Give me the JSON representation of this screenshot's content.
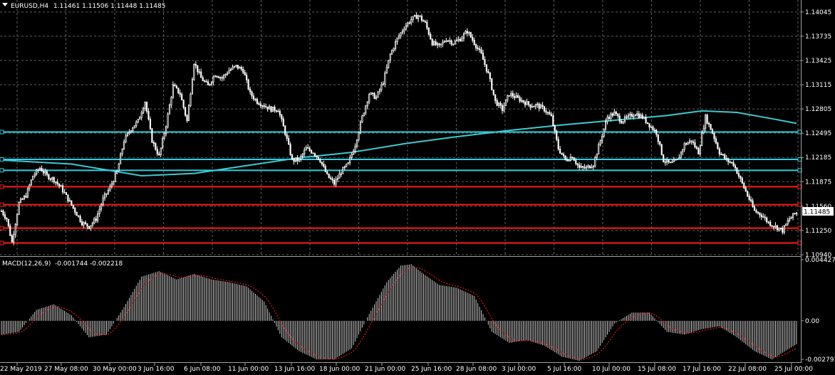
{
  "header": {
    "symbol_label": "EURUSD,H4",
    "ohlc": "1.11461 1.11506 1.11448 1.11485"
  },
  "macd": {
    "label": "MACD(12,26,9)",
    "values": "-0.001744 -0.002218"
  },
  "colors": {
    "background": "#000000",
    "grid": "#606060",
    "candle": "#ffffff",
    "ma": "#40c8d0",
    "cyan_level": "#30d0e0",
    "red_level": "#ff1a1a",
    "signal": "#ff2020",
    "text": "#ffffff",
    "price_box_bg": "#ffffff",
    "price_box_text": "#000000"
  },
  "price_axis": {
    "ticks": [
      "1.14045",
      "1.13735",
      "1.13425",
      "1.13115",
      "1.12805",
      "1.12495",
      "1.12185",
      "1.11875",
      "1.11560",
      "1.11250",
      "1.10940"
    ],
    "current": "1.11485"
  },
  "macd_axis": {
    "ticks": [
      "0.004427",
      "0.00",
      "-0.002793"
    ]
  },
  "time_axis": {
    "labels": [
      "22 May 2019",
      "27 May 08:00",
      "30 May 00:00",
      "3 Jun 16:00",
      "6 Jun 08:00",
      "11 Jun 00:00",
      "13 Jun 16:00",
      "18 Jun 00:00",
      "21 Jun 00:00",
      "25 Jun 16:00",
      "28 Jun 08:00",
      "3 Jul 00:00",
      "5 Jul 16:00",
      "10 Jul 00:00",
      "15 Jul 08:00",
      "17 Jul 16:00",
      "22 Jul 08:00",
      "25 Jul 00:00"
    ]
  },
  "chart_data": {
    "type": "candlestick",
    "symbol": "EURUSD",
    "timeframe": "H4",
    "ylim": [
      1.1094,
      1.1418
    ],
    "macd_range": [
      -0.002793,
      0.004427
    ],
    "horizontal_levels": {
      "cyan": [
        1.1251,
        1.1216,
        1.1202
      ],
      "red": [
        1.1181,
        1.1158,
        1.1128,
        1.1109
      ]
    },
    "close_path": [
      [
        0,
        1.115
      ],
      [
        3,
        1.114
      ],
      [
        6,
        1.111
      ],
      [
        10,
        1.116
      ],
      [
        14,
        1.117
      ],
      [
        18,
        1.1195
      ],
      [
        22,
        1.1205
      ],
      [
        26,
        1.1195
      ],
      [
        30,
        1.119
      ],
      [
        34,
        1.118
      ],
      [
        38,
        1.1165
      ],
      [
        42,
        1.115
      ],
      [
        46,
        1.1135
      ],
      [
        50,
        1.113
      ],
      [
        54,
        1.114
      ],
      [
        58,
        1.1165
      ],
      [
        62,
        1.118
      ],
      [
        66,
        1.12
      ],
      [
        70,
        1.124
      ],
      [
        74,
        1.1255
      ],
      [
        78,
        1.1265
      ],
      [
        82,
        1.129
      ],
      [
        86,
        1.124
      ],
      [
        90,
        1.122
      ],
      [
        94,
        1.126
      ],
      [
        98,
        1.131
      ],
      [
        102,
        1.13
      ],
      [
        106,
        1.1265
      ],
      [
        110,
        1.134
      ],
      [
        114,
        1.132
      ],
      [
        118,
        1.131
      ],
      [
        122,
        1.1325
      ],
      [
        126,
        1.132
      ],
      [
        130,
        1.133
      ],
      [
        134,
        1.1335
      ],
      [
        138,
        1.133
      ],
      [
        142,
        1.13
      ],
      [
        146,
        1.129
      ],
      [
        150,
        1.1285
      ],
      [
        154,
        1.128
      ],
      [
        158,
        1.128
      ],
      [
        162,
        1.125
      ],
      [
        166,
        1.1215
      ],
      [
        170,
        1.1215
      ],
      [
        174,
        1.123
      ],
      [
        178,
        1.1225
      ],
      [
        182,
        1.1215
      ],
      [
        186,
        1.1195
      ],
      [
        190,
        1.1185
      ],
      [
        194,
        1.12
      ],
      [
        198,
        1.121
      ],
      [
        202,
        1.1235
      ],
      [
        206,
        1.127
      ],
      [
        210,
        1.13
      ],
      [
        214,
        1.1295
      ],
      [
        218,
        1.1315
      ],
      [
        222,
        1.135
      ],
      [
        226,
        1.137
      ],
      [
        230,
        1.1385
      ],
      [
        234,
        1.1395
      ],
      [
        238,
        1.14
      ],
      [
        242,
        1.139
      ],
      [
        246,
        1.1365
      ],
      [
        250,
        1.136
      ],
      [
        254,
        1.137
      ],
      [
        258,
        1.1365
      ],
      [
        262,
        1.137
      ],
      [
        266,
        1.138
      ],
      [
        270,
        1.1365
      ],
      [
        274,
        1.135
      ],
      [
        278,
        1.1325
      ],
      [
        282,
        1.129
      ],
      [
        286,
        1.128
      ],
      [
        290,
        1.13
      ],
      [
        294,
        1.1295
      ],
      [
        298,
        1.129
      ],
      [
        302,
        1.1285
      ],
      [
        306,
        1.1285
      ],
      [
        310,
        1.128
      ],
      [
        314,
        1.127
      ],
      [
        318,
        1.123
      ],
      [
        322,
        1.1215
      ],
      [
        326,
        1.122
      ],
      [
        330,
        1.1205
      ],
      [
        334,
        1.1205
      ],
      [
        338,
        1.121
      ],
      [
        342,
        1.124
      ],
      [
        346,
        1.127
      ],
      [
        350,
        1.1275
      ],
      [
        354,
        1.1265
      ],
      [
        358,
        1.127
      ],
      [
        362,
        1.1275
      ],
      [
        366,
        1.127
      ],
      [
        370,
        1.126
      ],
      [
        374,
        1.125
      ],
      [
        378,
        1.1215
      ],
      [
        382,
        1.121
      ],
      [
        386,
        1.1215
      ],
      [
        390,
        1.1235
      ],
      [
        394,
        1.124
      ],
      [
        398,
        1.1225
      ],
      [
        402,
        1.127
      ],
      [
        406,
        1.125
      ],
      [
        410,
        1.1225
      ],
      [
        414,
        1.1215
      ],
      [
        418,
        1.121
      ],
      [
        422,
        1.119
      ],
      [
        426,
        1.117
      ],
      [
        430,
        1.115
      ],
      [
        434,
        1.1145
      ],
      [
        438,
        1.1135
      ],
      [
        442,
        1.113
      ],
      [
        446,
        1.1125
      ],
      [
        450,
        1.114
      ],
      [
        454,
        1.1148
      ]
    ],
    "moving_average": [
      [
        0,
        1.1215
      ],
      [
        40,
        1.121
      ],
      [
        80,
        1.1195
      ],
      [
        110,
        1.1198
      ],
      [
        140,
        1.1208
      ],
      [
        170,
        1.1218
      ],
      [
        200,
        1.1225
      ],
      [
        230,
        1.1236
      ],
      [
        260,
        1.1245
      ],
      [
        290,
        1.1253
      ],
      [
        320,
        1.126
      ],
      [
        350,
        1.1266
      ],
      [
        380,
        1.1272
      ],
      [
        400,
        1.1278
      ],
      [
        420,
        1.1276
      ],
      [
        440,
        1.1268
      ],
      [
        454,
        1.1262
      ]
    ],
    "macd_histogram_path": [
      [
        0,
        -0.001
      ],
      [
        10,
        -0.0008
      ],
      [
        20,
        0.0008
      ],
      [
        30,
        0.0012
      ],
      [
        40,
        0.0004
      ],
      [
        50,
        -0.0012
      ],
      [
        60,
        -0.001
      ],
      [
        70,
        0.001
      ],
      [
        80,
        0.0032
      ],
      [
        90,
        0.0036
      ],
      [
        100,
        0.003
      ],
      [
        110,
        0.0034
      ],
      [
        120,
        0.003
      ],
      [
        130,
        0.0028
      ],
      [
        140,
        0.0025
      ],
      [
        150,
        0.0014
      ],
      [
        160,
        -0.0012
      ],
      [
        170,
        -0.0022
      ],
      [
        180,
        -0.0028
      ],
      [
        190,
        -0.0028
      ],
      [
        200,
        -0.002
      ],
      [
        210,
        0.0005
      ],
      [
        220,
        0.0028
      ],
      [
        228,
        0.004
      ],
      [
        234,
        0.0041
      ],
      [
        240,
        0.0035
      ],
      [
        250,
        0.0026
      ],
      [
        260,
        0.0024
      ],
      [
        270,
        0.0018
      ],
      [
        280,
        -0.0008
      ],
      [
        290,
        -0.0016
      ],
      [
        300,
        -0.0014
      ],
      [
        310,
        -0.0018
      ],
      [
        320,
        -0.0026
      ],
      [
        330,
        -0.0029
      ],
      [
        340,
        -0.0022
      ],
      [
        350,
        -0.0002
      ],
      [
        360,
        0.0006
      ],
      [
        370,
        0.0006
      ],
      [
        380,
        -0.0008
      ],
      [
        390,
        -0.001
      ],
      [
        400,
        -0.0006
      ],
      [
        410,
        -0.0004
      ],
      [
        420,
        -0.0012
      ],
      [
        430,
        -0.0022
      ],
      [
        440,
        -0.0028
      ],
      [
        450,
        -0.002
      ],
      [
        454,
        -0.0017
      ]
    ]
  }
}
